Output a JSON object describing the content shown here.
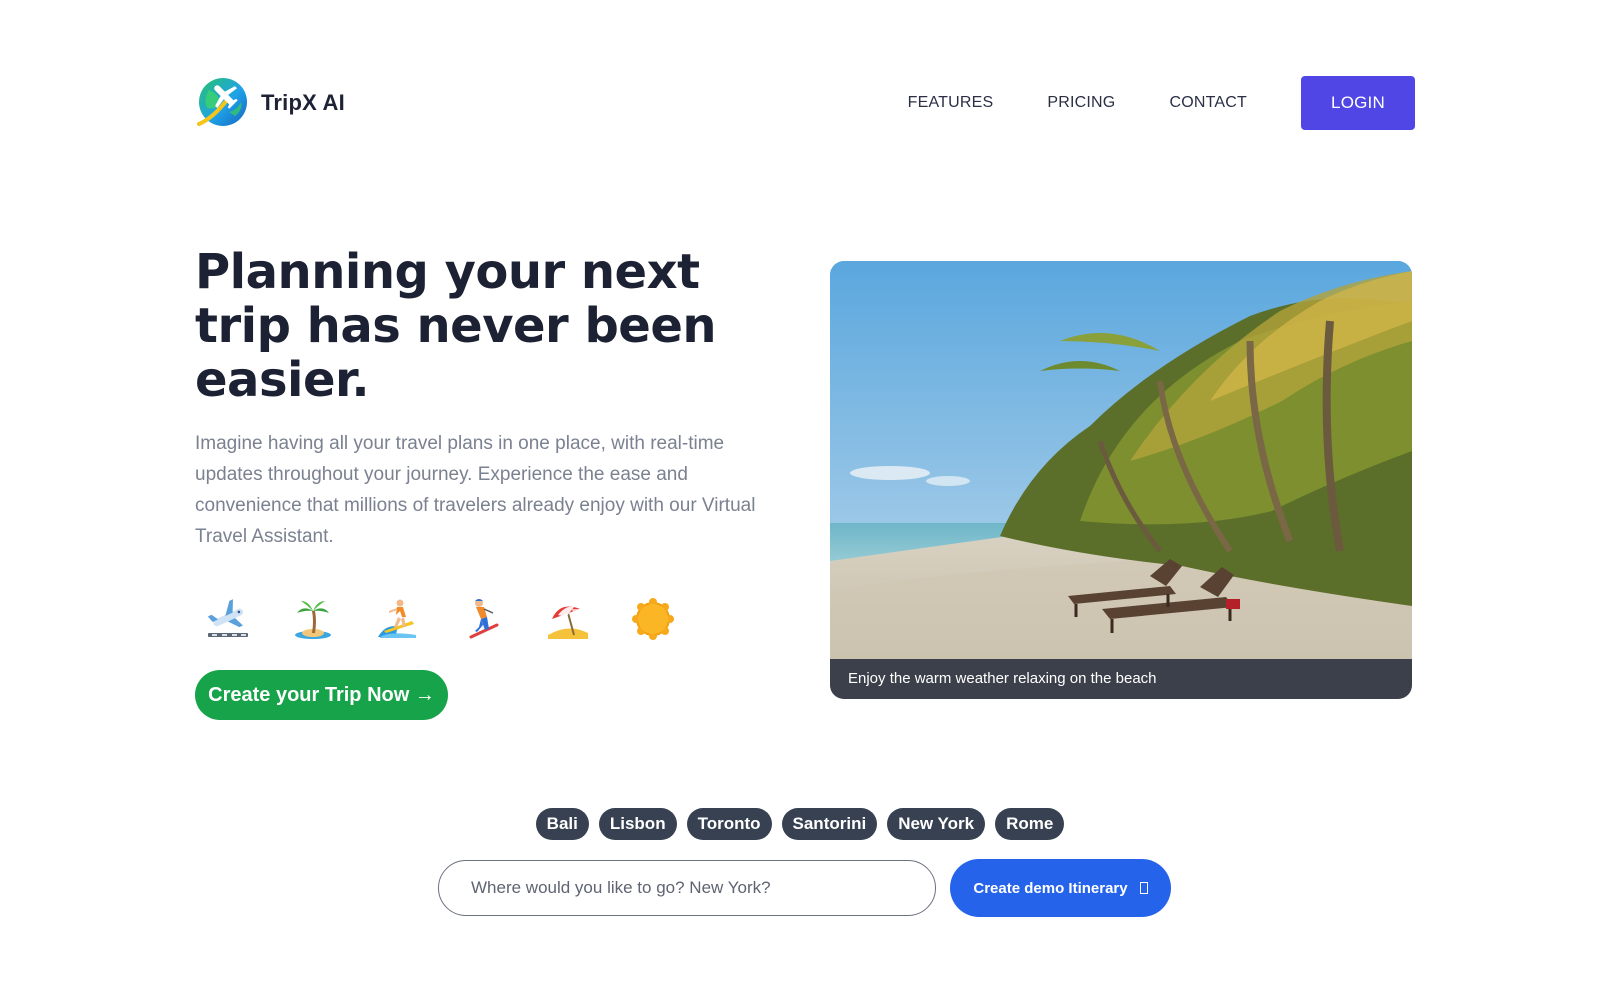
{
  "header": {
    "brand_name": "TripX AI",
    "nav": [
      "FEATURES",
      "PRICING",
      "CONTACT"
    ],
    "login_label": "LOGIN"
  },
  "hero": {
    "title": "Planning your next trip has never been easier.",
    "description": "Imagine having all your travel plans in one place, with real-time updates throughout your journey. Experience the ease and convenience that millions of travelers already enjoy with our Virtual Travel Assistant.",
    "emojis": [
      "airplane-departure-icon",
      "palm-island-icon",
      "surfer-icon",
      "skier-icon",
      "beach-umbrella-icon",
      "sun-icon"
    ],
    "cta_label": "Create your Trip Now →"
  },
  "photo": {
    "caption": "Enjoy the warm weather relaxing on the beach"
  },
  "destinations": [
    "Bali",
    "Lisbon",
    "Toronto",
    "Santorini",
    "New York",
    "Rome"
  ],
  "search": {
    "placeholder": "Where would you like to go? New York?",
    "value": "",
    "button_label": "Create demo Itinerary"
  },
  "colors": {
    "login": "#4f46e5",
    "cta": "#16a34a",
    "demo_button": "#2563eb",
    "chip": "#374151"
  }
}
